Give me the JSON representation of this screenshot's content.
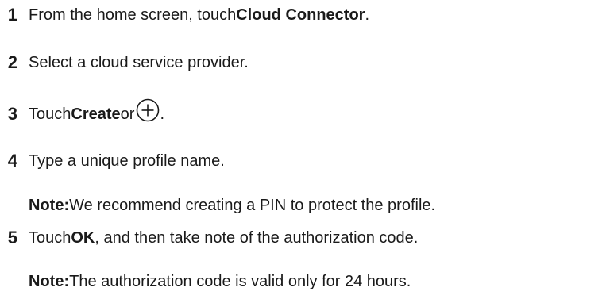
{
  "steps": [
    {
      "number": "1",
      "text_before": "From the home screen, touch ",
      "bold": "Cloud Connector",
      "text_after": "."
    },
    {
      "number": "2",
      "text": "Select a cloud service provider."
    },
    {
      "number": "3",
      "text_before": "Touch ",
      "bold": "Create",
      "text_middle": " or ",
      "icon": "plus-circle-icon",
      "text_after": "."
    },
    {
      "number": "4",
      "text": "Type a unique profile name."
    },
    {
      "note_label": "Note:",
      "note_text": " We recommend creating a PIN to protect the profile."
    },
    {
      "number": "5",
      "text_before": "Touch ",
      "bold": "OK",
      "text_after": ", and then take note of the authorization code."
    },
    {
      "note_label": "Note:",
      "note_text": " The authorization code is valid only for 24 hours."
    }
  ]
}
